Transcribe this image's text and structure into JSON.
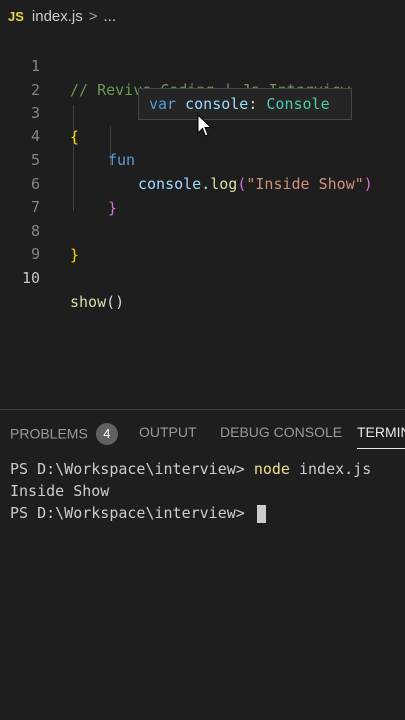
{
  "breadcrumb": {
    "file_icon": "JS",
    "filename": "index.js",
    "separator": ">",
    "more": "..."
  },
  "editor": {
    "lines": [
      {
        "n": "1",
        "text": "// Revive Coding | Js Interview"
      },
      {
        "n": "2",
        "text": ""
      },
      {
        "n": "3",
        "text": "{"
      },
      {
        "n": "4",
        "text": "fun"
      },
      {
        "n": "5",
        "obj": "console",
        "dot": ".",
        "method": "log",
        "open": "(",
        "str": "\"Inside Show\"",
        "close": ")"
      },
      {
        "n": "6",
        "text": "}"
      },
      {
        "n": "7",
        "text": ""
      },
      {
        "n": "8",
        "text": "}"
      },
      {
        "n": "9",
        "text": ""
      },
      {
        "n": "10",
        "fn": "show",
        "parens": "()"
      }
    ],
    "active_line": "10"
  },
  "tooltip": {
    "keyword": "var",
    "name": "console",
    "colon": ":",
    "type": "Console"
  },
  "panel": {
    "tabs": {
      "problems": "PROBLEMS",
      "problems_count": "4",
      "output": "OUTPUT",
      "debug": "DEBUG CONSOLE",
      "terminal": "TERMIN"
    }
  },
  "terminal": {
    "prompt1": "PS D:\\Workspace\\interview> ",
    "cmd": "node",
    "arg": " index.js",
    "output": "Inside Show",
    "prompt2": "PS D:\\Workspace\\interview> "
  },
  "colors": {
    "background": "#1e1e1e",
    "comment": "#6a9955",
    "function": "#dcdcaa",
    "string": "#ce9178",
    "bracket_gold": "#ffd700",
    "bracket_violet": "#da70d6"
  }
}
